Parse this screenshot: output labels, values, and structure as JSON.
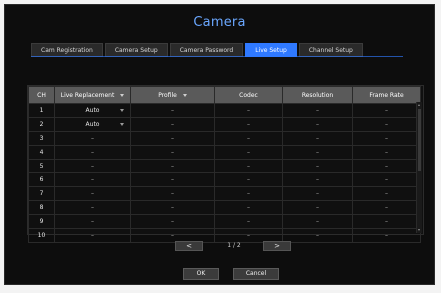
{
  "window": {
    "title": "Camera"
  },
  "tabs": [
    {
      "label": "Cam Registration",
      "active": false
    },
    {
      "label": "Camera Setup",
      "active": false
    },
    {
      "label": "Camera Password",
      "active": false
    },
    {
      "label": "Live Setup",
      "active": true
    },
    {
      "label": "Channel Setup",
      "active": false
    }
  ],
  "table": {
    "headers": {
      "ch": "CH",
      "live_replacement": "Live Replacement",
      "profile": "Profile",
      "codec": "Codec",
      "resolution": "Resolution",
      "frame_rate": "Frame Rate"
    },
    "rows": [
      {
        "ch": "1",
        "live_replacement": "Auto",
        "profile": "–",
        "codec": "–",
        "resolution": "–",
        "frame_rate": "–"
      },
      {
        "ch": "2",
        "live_replacement": "Auto",
        "profile": "–",
        "codec": "–",
        "resolution": "–",
        "frame_rate": "–"
      },
      {
        "ch": "3",
        "live_replacement": "–",
        "profile": "–",
        "codec": "–",
        "resolution": "–",
        "frame_rate": "–"
      },
      {
        "ch": "4",
        "live_replacement": "–",
        "profile": "–",
        "codec": "–",
        "resolution": "–",
        "frame_rate": "–"
      },
      {
        "ch": "5",
        "live_replacement": "–",
        "profile": "–",
        "codec": "–",
        "resolution": "–",
        "frame_rate": "–"
      },
      {
        "ch": "6",
        "live_replacement": "–",
        "profile": "–",
        "codec": "–",
        "resolution": "–",
        "frame_rate": "–"
      },
      {
        "ch": "7",
        "live_replacement": "–",
        "profile": "–",
        "codec": "–",
        "resolution": "–",
        "frame_rate": "–"
      },
      {
        "ch": "8",
        "live_replacement": "–",
        "profile": "–",
        "codec": "–",
        "resolution": "–",
        "frame_rate": "–"
      },
      {
        "ch": "9",
        "live_replacement": "–",
        "profile": "–",
        "codec": "–",
        "resolution": "–",
        "frame_rate": "–"
      },
      {
        "ch": "10",
        "live_replacement": "–",
        "profile": "–",
        "codec": "–",
        "resolution": "–",
        "frame_rate": "–"
      }
    ]
  },
  "pager": {
    "prev_label": "<",
    "page_text": "1 / 2",
    "next_label": ">"
  },
  "buttons": {
    "ok_label": "OK",
    "cancel_label": "Cancel"
  },
  "colors": {
    "accent": "#2f79ff",
    "title": "#6aa7ff",
    "background": "#0d0d0d"
  }
}
